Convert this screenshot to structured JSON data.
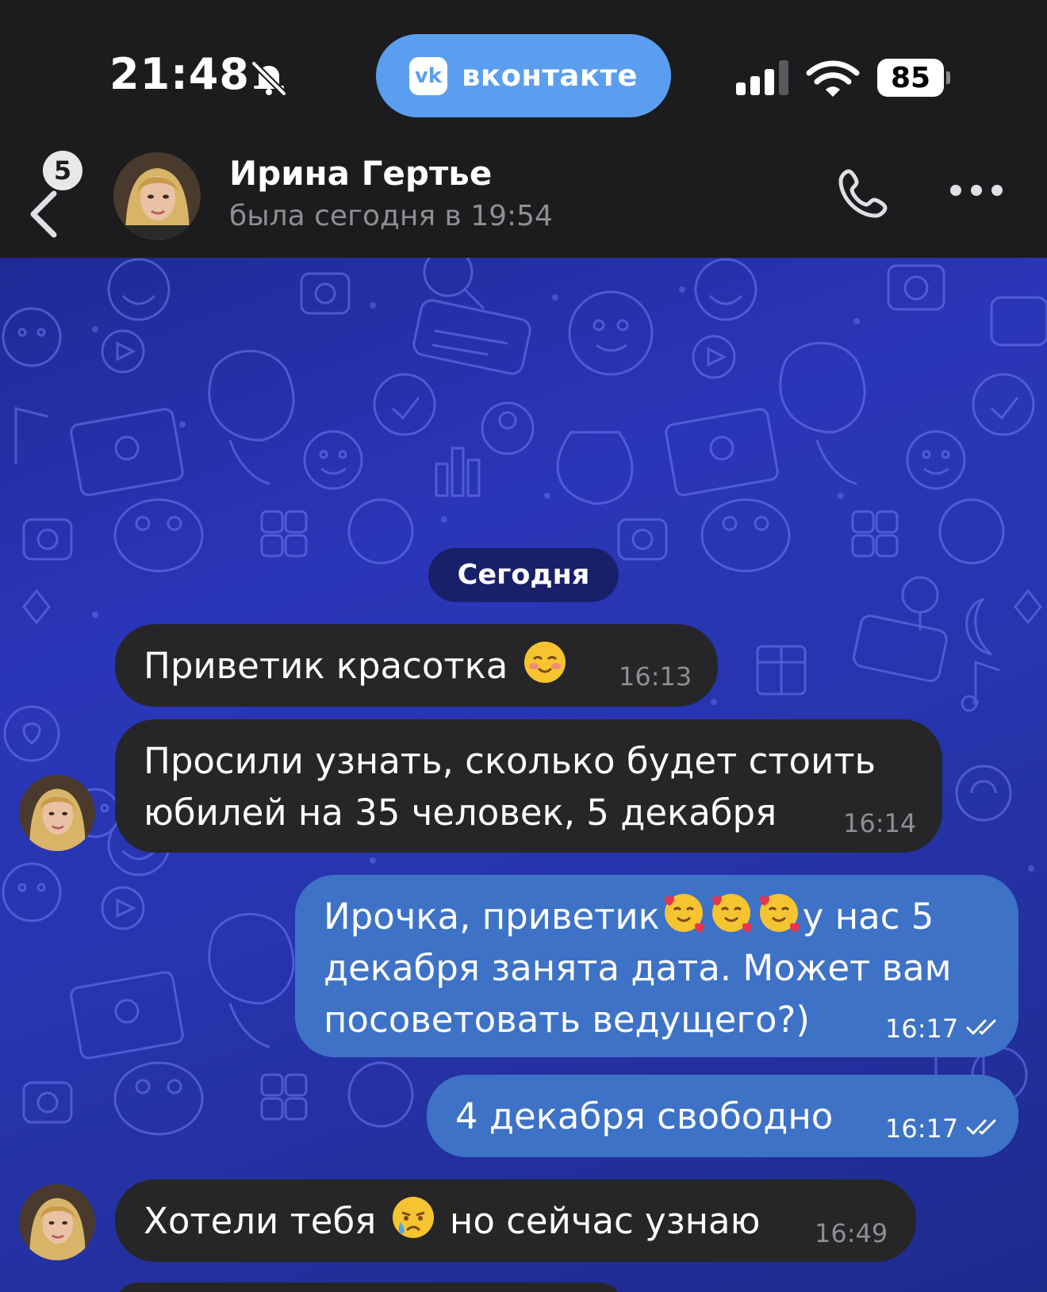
{
  "status_bar": {
    "time": "21:48",
    "app_pill": {
      "logo": "vk",
      "name": "вконтакте"
    },
    "battery": "85",
    "icons": [
      "bell-slash-icon",
      "signal-icon",
      "wifi-icon",
      "battery-icon"
    ]
  },
  "header": {
    "unread_count": "5",
    "contact_name": "Ирина Гертье",
    "last_seen": "была сегодня в 19:54",
    "icons": [
      "back-icon",
      "phone-icon",
      "more-icon"
    ]
  },
  "chat": {
    "date_separator": "Сегодня",
    "messages": [
      {
        "direction": "in",
        "parts": [
          "Приветик красотка",
          " "
        ],
        "emoji_after": [
          "smiling-blush"
        ],
        "time": "16:13"
      },
      {
        "direction": "in",
        "text": "Просили узнать, сколько будет стоить\nюбилей на 35 человек, 5 декабря",
        "time": "16:14"
      },
      {
        "direction": "out",
        "line1_before": "Ирочка, приветик",
        "line1_after": "у нас 5",
        "emojis": [
          "smiling-hearts",
          "smiling-hearts",
          "smiling-hearts"
        ],
        "rest": "декабря занята дата. Может вам\nпосоветовать ведущего?)",
        "time": "16:17",
        "status": "read"
      },
      {
        "direction": "out",
        "text": "4 декабря свободно",
        "time": "16:17",
        "status": "read"
      },
      {
        "direction": "in",
        "before": "Хотели тебя",
        "after": "но сейчас узнаю",
        "emoji": "crying-face",
        "time": "16:49"
      }
    ]
  },
  "colors": {
    "incoming_bubble": "#262628",
    "outgoing_bubble": "#3d72c6",
    "vk_accent": "#5b9ef0",
    "chat_background": "#2735ae"
  }
}
